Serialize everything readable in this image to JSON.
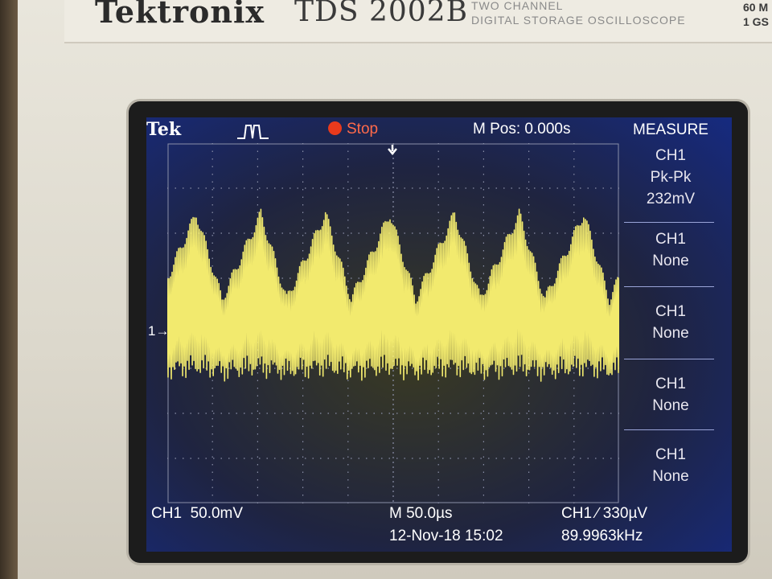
{
  "instrument": {
    "brand": "Tektronix",
    "model": "TDS 2002B",
    "description_line1": "TWO CHANNEL",
    "description_line2": "DIGITAL STORAGE OSCILLOSCOPE",
    "spec_line1": "60 M",
    "spec_line2": "1 GS"
  },
  "screen": {
    "logo": "Tek",
    "acquire_icon": "pulse-icon",
    "run_state": "Stop",
    "run_state_color": "#e83a1c",
    "m_pos": "M Pos: 0.000s",
    "menu_title": "MEASURE",
    "channel_marker": "1",
    "trace_color": "#f2ea6e",
    "background_color": "#162a80"
  },
  "measure_menu": [
    {
      "source": "CH1",
      "type": "Pk-Pk",
      "value": "232mV"
    },
    {
      "source": "CH1",
      "type": "None"
    },
    {
      "source": "CH1",
      "type": "None"
    },
    {
      "source": "CH1",
      "type": "None"
    },
    {
      "source": "CH1",
      "type": "None"
    }
  ],
  "footer": {
    "ch1_scale_label": "CH1",
    "ch1_scale_value": "50.0mV",
    "timebase": "M 50.0µs",
    "trigger": "CH1 ∕ 330µV",
    "date_time": "12-Nov-18 15:02",
    "frequency": "89.9963kHz"
  },
  "waveform": {
    "cycles": 7,
    "envelope_min_div": -1.6,
    "envelope_max_div": 2.6,
    "pkpk": "232mV"
  }
}
